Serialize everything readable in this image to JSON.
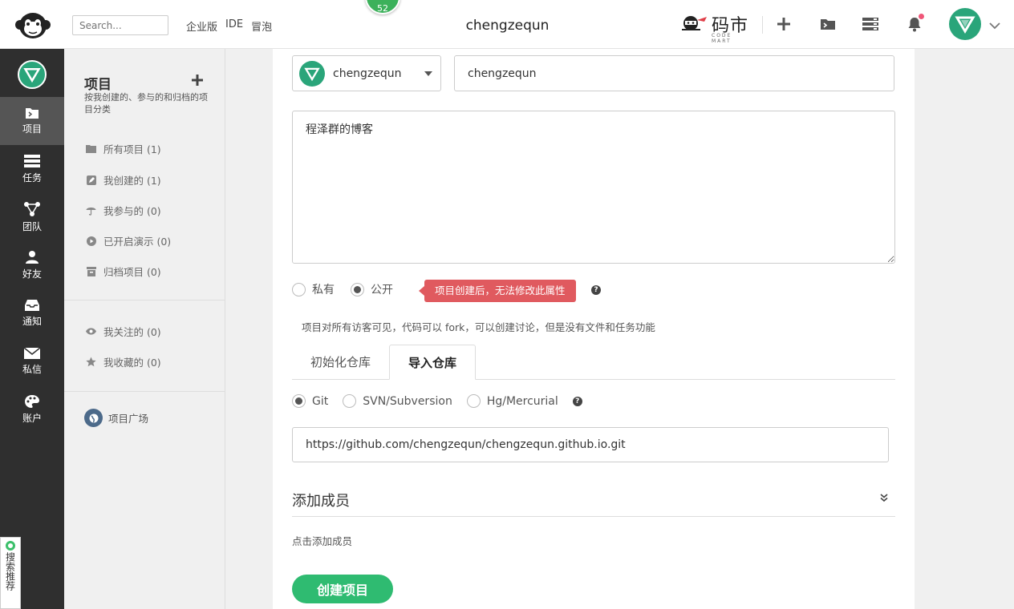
{
  "topbar": {
    "search_placeholder": "Search...",
    "nav": [
      "企业版",
      "IDE",
      "冒泡"
    ],
    "badge_count": "52",
    "title": "chengzequn",
    "brand_text": "码市",
    "brand_sub": "CODE MART"
  },
  "leftbar": {
    "items": [
      "项目",
      "任务",
      "团队",
      "好友",
      "通知",
      "私信",
      "账户"
    ],
    "recommend": "搜索推荐"
  },
  "sidebar": {
    "title": "项目",
    "description": "按我创建的、参与的和归档的项目分类",
    "items": [
      "所有项目 (1)",
      "我创建的 (1)",
      "我参与的 (0)",
      "已开启演示 (0)",
      "归档项目 (0)"
    ],
    "items2": [
      "我关注的 (0)",
      "我收藏的 (0)"
    ],
    "plaza": "项目广场"
  },
  "form": {
    "owner": "chengzequn",
    "project_name": "chengzequn",
    "description": "程泽群的博客",
    "visibility": {
      "private": "私有",
      "public": "公开",
      "selected": "public"
    },
    "visibility_tip": "项目创建后，无法修改此属性",
    "visibility_note": "项目对所有访客可见，代码可以 fork，可以创建讨论，但是没有文件和任务功能",
    "tabs": [
      "初始化仓库",
      "导入仓库"
    ],
    "active_tab": "导入仓库",
    "vcs": [
      "Git",
      "SVN/Subversion",
      "Hg/Mercurial"
    ],
    "vcs_selected": "Git",
    "repo_url": "https://github.com/chengzequn/chengzequn.github.io.git",
    "members_title": "添加成员",
    "members_add": "点击添加成员",
    "create_button": "创建项目"
  },
  "colors": {
    "accent": "#2fbb71",
    "tip": "#e05a5f",
    "avatar": "#2aa57a",
    "sidebar_dark": "#2f2f2f"
  }
}
